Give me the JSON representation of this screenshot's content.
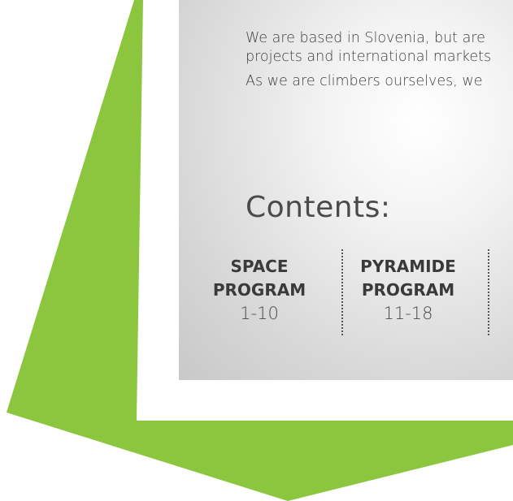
{
  "intro": {
    "paragraph_1_line_1": "We are based in Slovenia, but are",
    "paragraph_1_line_2": "projects and international markets",
    "paragraph_2": "As we are climbers ourselves, we"
  },
  "contents": {
    "heading": "Contents:",
    "entries": [
      {
        "name_line_1": "SPACE",
        "name_line_2": "PROGRAM",
        "pages": "1-10"
      },
      {
        "name_line_1": "PYRAMIDE",
        "name_line_2": "PROGRAM",
        "pages": "11-18"
      }
    ]
  },
  "colors": {
    "arrow_green": "#8cc63f",
    "text_dark": "#3f3f3f"
  }
}
